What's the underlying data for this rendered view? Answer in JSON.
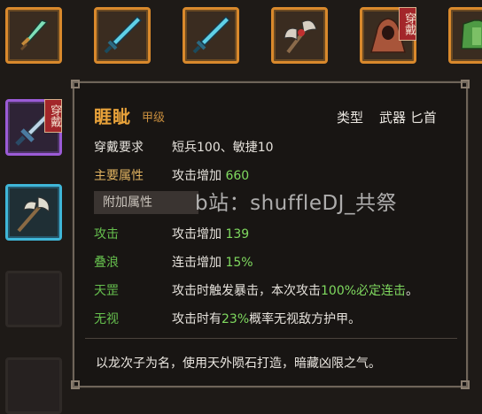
{
  "inventory": {
    "equipped_badge": "穿戴",
    "slots": [
      {
        "item": "jade-dagger",
        "rarity": "orange"
      },
      {
        "item": "cyan-sword",
        "rarity": "orange"
      },
      {
        "item": "cyan-sword",
        "rarity": "orange"
      },
      {
        "item": "battle-axe",
        "rarity": "orange"
      },
      {
        "item": "hooded-cloak",
        "rarity": "orange",
        "equipped": true
      },
      {
        "item": "green-armor",
        "rarity": "orange"
      },
      {
        "item": "steel-dagger",
        "rarity": "purple",
        "equipped": true
      },
      {
        "item": "halberd",
        "rarity": "cyan"
      }
    ]
  },
  "tooltip": {
    "name": "睚眦",
    "grade": "甲级",
    "type_label": "类型",
    "type_value": "武器 匕首",
    "requirement_label": "穿戴要求",
    "requirement_value": "短兵100、敏捷10",
    "main_label": "主要属性",
    "main_prefix": "攻击增加",
    "main_value": "660",
    "bonus_header": "附加属性",
    "bonuses": [
      {
        "label": "攻击",
        "prefix": "攻击增加",
        "value": "139",
        "suffix": ""
      },
      {
        "label": "叠浪",
        "prefix": "连击增加",
        "value": "15%",
        "suffix": ""
      },
      {
        "label": "天罡",
        "prefix": "攻击时触发暴击，本次攻击",
        "value": "100%必定连击",
        "suffix": "。"
      },
      {
        "label": "无视",
        "prefix": "攻击时有",
        "value": "23%",
        "suffix": "概率无视敌方护甲。"
      }
    ],
    "description": "以龙次子为名，使用天外陨石打造，暗藏凶限之气。"
  },
  "watermark": "b站：shuffleDJ_共祭",
  "colors": {
    "title": "#e8a23a",
    "label_gold": "#e0b260",
    "label_green": "#66c04e",
    "number_green": "#7fd95f",
    "rarity_orange": "#d9892c",
    "rarity_purple": "#9b5bd6",
    "rarity_cyan": "#3fb6d8"
  }
}
